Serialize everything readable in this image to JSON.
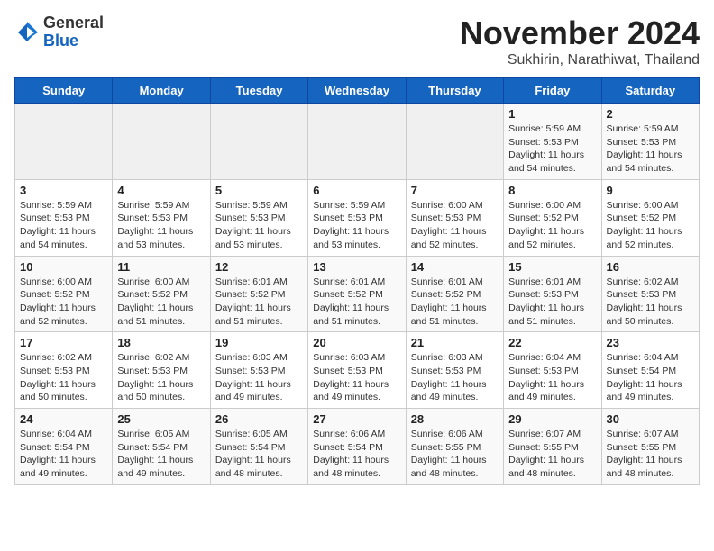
{
  "header": {
    "logo_line1": "General",
    "logo_line2": "Blue",
    "title": "November 2024",
    "subtitle": "Sukhirin, Narathiwat, Thailand"
  },
  "weekdays": [
    "Sunday",
    "Monday",
    "Tuesday",
    "Wednesday",
    "Thursday",
    "Friday",
    "Saturday"
  ],
  "weeks": [
    [
      {
        "day": "",
        "info": ""
      },
      {
        "day": "",
        "info": ""
      },
      {
        "day": "",
        "info": ""
      },
      {
        "day": "",
        "info": ""
      },
      {
        "day": "",
        "info": ""
      },
      {
        "day": "1",
        "info": "Sunrise: 5:59 AM\nSunset: 5:53 PM\nDaylight: 11 hours\nand 54 minutes."
      },
      {
        "day": "2",
        "info": "Sunrise: 5:59 AM\nSunset: 5:53 PM\nDaylight: 11 hours\nand 54 minutes."
      }
    ],
    [
      {
        "day": "3",
        "info": "Sunrise: 5:59 AM\nSunset: 5:53 PM\nDaylight: 11 hours\nand 54 minutes."
      },
      {
        "day": "4",
        "info": "Sunrise: 5:59 AM\nSunset: 5:53 PM\nDaylight: 11 hours\nand 53 minutes."
      },
      {
        "day": "5",
        "info": "Sunrise: 5:59 AM\nSunset: 5:53 PM\nDaylight: 11 hours\nand 53 minutes."
      },
      {
        "day": "6",
        "info": "Sunrise: 5:59 AM\nSunset: 5:53 PM\nDaylight: 11 hours\nand 53 minutes."
      },
      {
        "day": "7",
        "info": "Sunrise: 6:00 AM\nSunset: 5:53 PM\nDaylight: 11 hours\nand 52 minutes."
      },
      {
        "day": "8",
        "info": "Sunrise: 6:00 AM\nSunset: 5:52 PM\nDaylight: 11 hours\nand 52 minutes."
      },
      {
        "day": "9",
        "info": "Sunrise: 6:00 AM\nSunset: 5:52 PM\nDaylight: 11 hours\nand 52 minutes."
      }
    ],
    [
      {
        "day": "10",
        "info": "Sunrise: 6:00 AM\nSunset: 5:52 PM\nDaylight: 11 hours\nand 52 minutes."
      },
      {
        "day": "11",
        "info": "Sunrise: 6:00 AM\nSunset: 5:52 PM\nDaylight: 11 hours\nand 51 minutes."
      },
      {
        "day": "12",
        "info": "Sunrise: 6:01 AM\nSunset: 5:52 PM\nDaylight: 11 hours\nand 51 minutes."
      },
      {
        "day": "13",
        "info": "Sunrise: 6:01 AM\nSunset: 5:52 PM\nDaylight: 11 hours\nand 51 minutes."
      },
      {
        "day": "14",
        "info": "Sunrise: 6:01 AM\nSunset: 5:52 PM\nDaylight: 11 hours\nand 51 minutes."
      },
      {
        "day": "15",
        "info": "Sunrise: 6:01 AM\nSunset: 5:53 PM\nDaylight: 11 hours\nand 51 minutes."
      },
      {
        "day": "16",
        "info": "Sunrise: 6:02 AM\nSunset: 5:53 PM\nDaylight: 11 hours\nand 50 minutes."
      }
    ],
    [
      {
        "day": "17",
        "info": "Sunrise: 6:02 AM\nSunset: 5:53 PM\nDaylight: 11 hours\nand 50 minutes."
      },
      {
        "day": "18",
        "info": "Sunrise: 6:02 AM\nSunset: 5:53 PM\nDaylight: 11 hours\nand 50 minutes."
      },
      {
        "day": "19",
        "info": "Sunrise: 6:03 AM\nSunset: 5:53 PM\nDaylight: 11 hours\nand 49 minutes."
      },
      {
        "day": "20",
        "info": "Sunrise: 6:03 AM\nSunset: 5:53 PM\nDaylight: 11 hours\nand 49 minutes."
      },
      {
        "day": "21",
        "info": "Sunrise: 6:03 AM\nSunset: 5:53 PM\nDaylight: 11 hours\nand 49 minutes."
      },
      {
        "day": "22",
        "info": "Sunrise: 6:04 AM\nSunset: 5:53 PM\nDaylight: 11 hours\nand 49 minutes."
      },
      {
        "day": "23",
        "info": "Sunrise: 6:04 AM\nSunset: 5:54 PM\nDaylight: 11 hours\nand 49 minutes."
      }
    ],
    [
      {
        "day": "24",
        "info": "Sunrise: 6:04 AM\nSunset: 5:54 PM\nDaylight: 11 hours\nand 49 minutes."
      },
      {
        "day": "25",
        "info": "Sunrise: 6:05 AM\nSunset: 5:54 PM\nDaylight: 11 hours\nand 49 minutes."
      },
      {
        "day": "26",
        "info": "Sunrise: 6:05 AM\nSunset: 5:54 PM\nDaylight: 11 hours\nand 48 minutes."
      },
      {
        "day": "27",
        "info": "Sunrise: 6:06 AM\nSunset: 5:54 PM\nDaylight: 11 hours\nand 48 minutes."
      },
      {
        "day": "28",
        "info": "Sunrise: 6:06 AM\nSunset: 5:55 PM\nDaylight: 11 hours\nand 48 minutes."
      },
      {
        "day": "29",
        "info": "Sunrise: 6:07 AM\nSunset: 5:55 PM\nDaylight: 11 hours\nand 48 minutes."
      },
      {
        "day": "30",
        "info": "Sunrise: 6:07 AM\nSunset: 5:55 PM\nDaylight: 11 hours\nand 48 minutes."
      }
    ]
  ]
}
